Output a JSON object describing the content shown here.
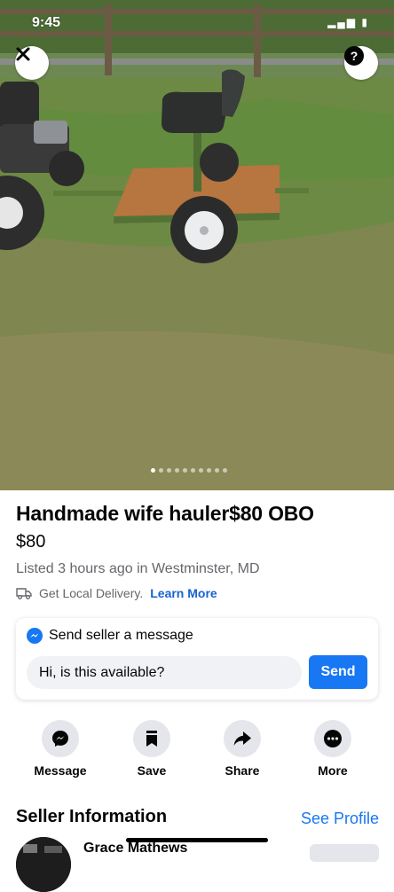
{
  "status_bar": {
    "time": "9:45"
  },
  "photo": {
    "page_count": 10,
    "active_index": 0
  },
  "listing": {
    "title": "Handmade wife hauler$80 OBO",
    "price": "$80",
    "listed": "Listed 3 hours ago in Westminster, MD",
    "delivery_text": "Get Local Delivery.",
    "delivery_link": "Learn More"
  },
  "message": {
    "heading": "Send seller a message",
    "input_value": "Hi, is this available?",
    "send_label": "Send"
  },
  "actions": [
    {
      "label": "Message",
      "icon": "messenger-icon"
    },
    {
      "label": "Save",
      "icon": "bookmark-icon"
    },
    {
      "label": "Share",
      "icon": "share-icon"
    },
    {
      "label": "More",
      "icon": "more-dots-icon"
    }
  ],
  "seller": {
    "heading": "Seller Information",
    "see_profile": "See Profile",
    "name": "Grace Mathews"
  },
  "colors": {
    "accent": "#1877f2",
    "link": "#1763cf",
    "secondary_text": "#65676b",
    "icon_bg": "#e4e6eb"
  }
}
